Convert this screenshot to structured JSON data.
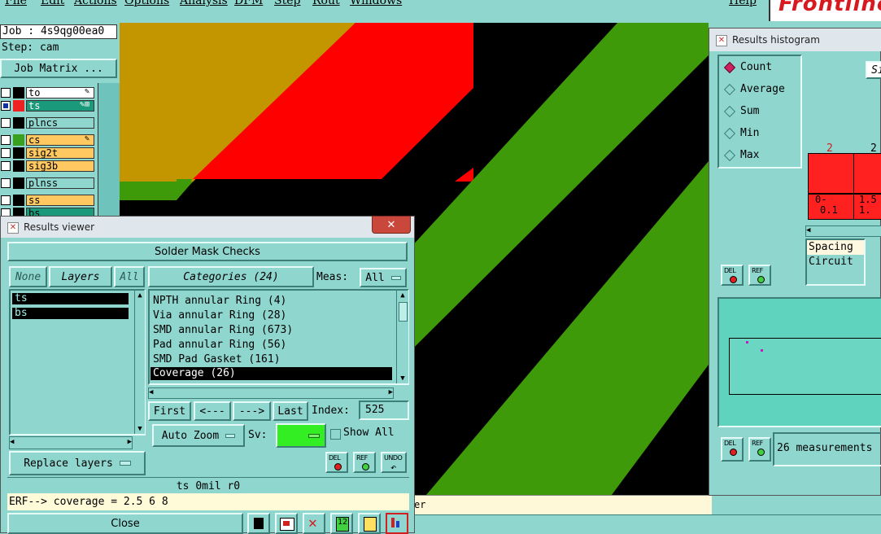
{
  "menubar": {
    "items": [
      "File",
      "Edit",
      "Actions",
      "Options",
      "Analysis",
      "DFM",
      "Step",
      "Rout",
      "Windows"
    ],
    "help": "Help",
    "logo": "Frontline"
  },
  "left_panel": {
    "job": "Job : 4s9qg00ea0",
    "step": "Step: cam",
    "job_matrix": "Job Matrix ...",
    "layers": [
      {
        "name": "to",
        "color": "#000000",
        "bg": "#ffffff"
      },
      {
        "name": "ts",
        "color": "#ee2222",
        "bg": "#1a9a7a",
        "active": true
      },
      {
        "name": "plncs",
        "color": "#000000",
        "bg": "#8fd6cf"
      },
      {
        "name": "cs",
        "color": "#3aa020",
        "bg": "#ffc860"
      },
      {
        "name": "sig2t",
        "color": "#000000",
        "bg": "#ffc860"
      },
      {
        "name": "sig3b",
        "color": "#000000",
        "bg": "#ffc860"
      },
      {
        "name": "plnss",
        "color": "#000000",
        "bg": "#8fd6cf"
      },
      {
        "name": "ss",
        "color": "#000000",
        "bg": "#ffc860"
      },
      {
        "name": "bs",
        "color": "#000000",
        "bg": "#1a9a7a"
      }
    ]
  },
  "results_viewer": {
    "title": "Results viewer",
    "heading": "Solder Mask Checks",
    "none_btn": "None",
    "layers_btn": "Layers",
    "all_btn": "All",
    "layer_list": [
      "ts",
      "bs"
    ],
    "categories_btn": "Categories (24)",
    "meas_label": "Meas:",
    "meas_value": "All",
    "categories": [
      "NPTH annular Ring (4)",
      "Via annular Ring (28)",
      "SMD annular Ring (673)",
      "Pad annular Ring (56)",
      "SMD Pad Gasket (161)",
      "Coverage (26)"
    ],
    "selected_category_index": 5,
    "first_btn": "First",
    "prev_btn": "<---",
    "next_btn": "--->",
    "last_btn": "Last",
    "index_label": "Index:",
    "index_value": "525",
    "auto_zoom": "Auto Zoom",
    "sv_label": "Sv:",
    "show_all": "Show All",
    "del": "DEL",
    "ref": "REF",
    "undo": "UNDO",
    "replace_layers": "Replace layers",
    "status_line": "ts  0mil  r0",
    "erf_line": "ERF--> coverage = 2.5 6 8",
    "close": "Close",
    "tail_text": "er"
  },
  "histogram": {
    "title": "Results histogram",
    "modes": [
      "Count",
      "Average",
      "Sum",
      "Min",
      "Max"
    ],
    "selected_mode": "Count",
    "size_btn": "Si",
    "bars": [
      {
        "count": "2",
        "range_top": "0-",
        "range_bottom": "0.1"
      },
      {
        "count": "2",
        "range_top": "1.5",
        "range_bottom": "1."
      }
    ],
    "list_items": [
      "Spacing",
      "Circuit"
    ],
    "del": "DEL",
    "ref": "REF",
    "measurements": "26 measurements"
  },
  "colors": {
    "panel": "#8fd6cf",
    "board_green": "#3f9a09",
    "board_red": "#ff0000",
    "board_olive": "#c39600",
    "board_black": "#000000"
  }
}
